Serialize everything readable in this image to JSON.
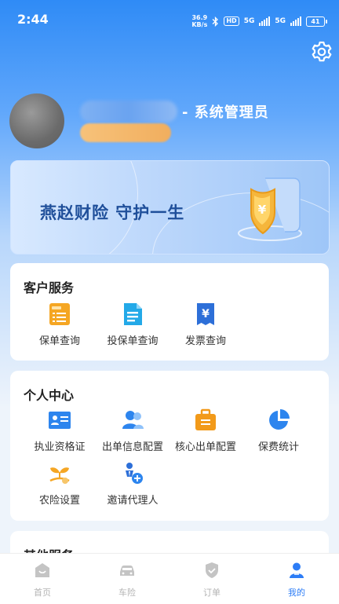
{
  "status": {
    "time": "2:44",
    "net_speed_value": "36.9",
    "net_speed_unit": "KB/s",
    "hd": "HD",
    "network": "5G",
    "battery": "41"
  },
  "profile": {
    "role": "- 系统管理员"
  },
  "banner": {
    "slogan": "燕赵财险 守护一生"
  },
  "customer_service": {
    "title": "客户服务",
    "items": [
      {
        "label": "保单查询",
        "icon": "policy-icon"
      },
      {
        "label": "投保单查询",
        "icon": "document-icon"
      },
      {
        "label": "发票查询",
        "icon": "invoice-icon"
      }
    ]
  },
  "personal_center": {
    "title": "个人中心",
    "items": [
      {
        "label": "执业资格证",
        "icon": "certificate-icon"
      },
      {
        "label": "出单信息配置",
        "icon": "people-icon"
      },
      {
        "label": "核心出单配置",
        "icon": "briefcase-icon"
      },
      {
        "label": "保费统计",
        "icon": "pie-chart-icon"
      },
      {
        "label": "农险设置",
        "icon": "plant-icon"
      },
      {
        "label": "邀请代理人",
        "icon": "invite-icon"
      }
    ]
  },
  "other_services": {
    "title": "其他服务"
  },
  "tabbar": [
    {
      "label": "首页",
      "icon": "home-icon",
      "active": false
    },
    {
      "label": "车险",
      "icon": "car-icon",
      "active": false
    },
    {
      "label": "订单",
      "icon": "order-shield-icon",
      "active": false
    },
    {
      "label": "我的",
      "icon": "person-icon",
      "active": true
    }
  ],
  "colors": {
    "accent": "#2d7df6",
    "orange": "#f5a623",
    "banner_text": "#1f4f9a"
  }
}
